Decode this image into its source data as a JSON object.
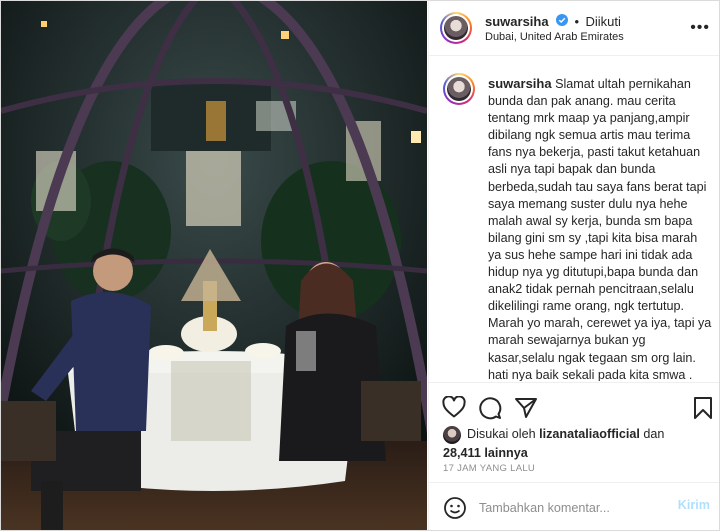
{
  "header": {
    "username": "suwarsiha",
    "separator": "•",
    "follow_status": "Diikuti",
    "location": "Dubai, United Arab Emirates",
    "more_icon": "more-options-icon"
  },
  "caption": {
    "username": "suwarsiha",
    "text": "Slamat ultah pernikahan bunda dan pak anang. mau cerita tentang mrk maap ya panjang,ampir dibilang ngk semua artis mau terima fans nya bekerja, pasti takut ketahuan asli nya tapi bapak dan bunda berbeda,sudah tau saya fans berat tapi saya memang suster dulu nya hehe malah awal sy kerja, bunda sm bapa bilang gini sm sy ,tapi kita bisa marah ya sus hehe sampe hari ini tidak ada hidup nya yg ditutupi,bapa bunda dan anak2 tidak pernah pencitraan,selalu dikelilingi rame orang, ngk tertutup. Marah yo marah, cerewet ya iya, tapi ya marah sewajarnya bukan yg kasar,selalu ngak tegaan sm org lain. hati nya baik sekali pada kita smwa . Suka"
  },
  "actions": {
    "icons": [
      "heart-icon",
      "comment-icon",
      "share-icon",
      "bookmark-icon"
    ]
  },
  "likes": {
    "prefix": "Disukai oleh",
    "liker": "lizanataliaofficial",
    "connector": "dan",
    "others": "28,411 lainnya"
  },
  "timestamp": "17 JAM YANG LALU",
  "comment": {
    "placeholder": "Tambahkan komentar...",
    "post_label": "Kirim"
  },
  "colors": {
    "accent": "#0095f6",
    "post_disabled": "#b2dffc",
    "verified": "#3897f0",
    "muted": "#8e8e8e"
  }
}
